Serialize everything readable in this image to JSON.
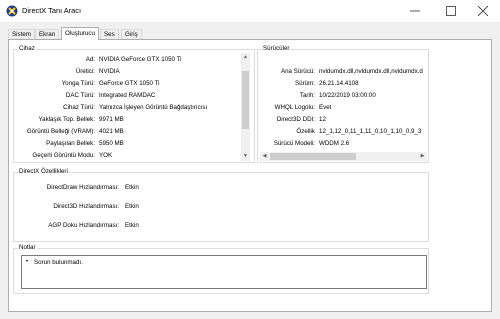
{
  "window": {
    "title": "DirectX Tanı Aracı"
  },
  "tabs": [
    {
      "label": "Sistem"
    },
    {
      "label": "Ekran"
    },
    {
      "label": "Oluşturucu"
    },
    {
      "label": "Ses"
    },
    {
      "label": "Giriş"
    }
  ],
  "device": {
    "title": "Cihaz",
    "rows": [
      {
        "label": "Ad:",
        "value": "NVIDIA GeForce GTX 1050 Ti"
      },
      {
        "label": "Üretici:",
        "value": "NVIDIA"
      },
      {
        "label": "Yonga Türü:",
        "value": "GeForce GTX 1050 Ti"
      },
      {
        "label": "DAC Türü:",
        "value": "Integrated RAMDAC"
      },
      {
        "label": "Cihaz Türü:",
        "value": "Yalnızca İşleyen Görüntü Bağdaştırıcısı"
      },
      {
        "label": "Yaklaşık Top. Bellek:",
        "value": "9971 MB"
      },
      {
        "label": "Görüntü Belleği (VRAM):",
        "value": "4021 MB"
      },
      {
        "label": "Paylaşılan Bellek:",
        "value": "5950 MB"
      },
      {
        "label": "Geçerli Görüntü Modu:",
        "value": "YOK"
      }
    ]
  },
  "drivers": {
    "title": "Sürücüler",
    "rows": [
      {
        "label": "Ana Sürücü:",
        "value": "nvldumdx.dll,nvldumdx.dll,nvldumdx.d"
      },
      {
        "label": "Sürüm:",
        "value": "26.21.14.4108"
      },
      {
        "label": "Tarih:",
        "value": "10/22/2019 03:00:00"
      },
      {
        "label": "WHQL Logolu:",
        "value": "Evet"
      },
      {
        "label": "Direct3D DDI:",
        "value": "12"
      },
      {
        "label": "Özellik",
        "value": "12_1,12_0,11_1,11_0,10_1,10_0,9_3"
      },
      {
        "label": "Sürücü Modeli:",
        "value": "WDDM 2.6"
      }
    ]
  },
  "features": {
    "title": "DirectX Özellikleri",
    "rows": [
      {
        "label": "DirectDraw Hızlandırması:",
        "value": "Etkin"
      },
      {
        "label": "Direct3D Hızlandırması:",
        "value": "Etkin"
      },
      {
        "label": "AGP Doku Hızlandırması:",
        "value": "Etkin"
      }
    ]
  },
  "notes": {
    "title": "Notlar",
    "items": [
      "Sorun bulunmadı."
    ]
  }
}
